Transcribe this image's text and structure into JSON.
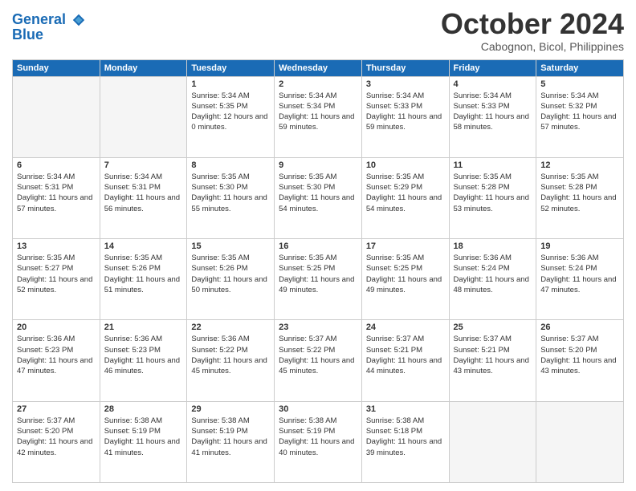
{
  "header": {
    "logo_line1": "General",
    "logo_line2": "Blue",
    "month": "October 2024",
    "location": "Cabognon, Bicol, Philippines"
  },
  "days_of_week": [
    "Sunday",
    "Monday",
    "Tuesday",
    "Wednesday",
    "Thursday",
    "Friday",
    "Saturday"
  ],
  "weeks": [
    [
      {
        "day": "",
        "empty": true
      },
      {
        "day": "",
        "empty": true
      },
      {
        "day": "1",
        "sunrise": "Sunrise: 5:34 AM",
        "sunset": "Sunset: 5:35 PM",
        "daylight": "Daylight: 12 hours and 0 minutes."
      },
      {
        "day": "2",
        "sunrise": "Sunrise: 5:34 AM",
        "sunset": "Sunset: 5:34 PM",
        "daylight": "Daylight: 11 hours and 59 minutes."
      },
      {
        "day": "3",
        "sunrise": "Sunrise: 5:34 AM",
        "sunset": "Sunset: 5:33 PM",
        "daylight": "Daylight: 11 hours and 59 minutes."
      },
      {
        "day": "4",
        "sunrise": "Sunrise: 5:34 AM",
        "sunset": "Sunset: 5:33 PM",
        "daylight": "Daylight: 11 hours and 58 minutes."
      },
      {
        "day": "5",
        "sunrise": "Sunrise: 5:34 AM",
        "sunset": "Sunset: 5:32 PM",
        "daylight": "Daylight: 11 hours and 57 minutes."
      }
    ],
    [
      {
        "day": "6",
        "sunrise": "Sunrise: 5:34 AM",
        "sunset": "Sunset: 5:31 PM",
        "daylight": "Daylight: 11 hours and 57 minutes."
      },
      {
        "day": "7",
        "sunrise": "Sunrise: 5:34 AM",
        "sunset": "Sunset: 5:31 PM",
        "daylight": "Daylight: 11 hours and 56 minutes."
      },
      {
        "day": "8",
        "sunrise": "Sunrise: 5:35 AM",
        "sunset": "Sunset: 5:30 PM",
        "daylight": "Daylight: 11 hours and 55 minutes."
      },
      {
        "day": "9",
        "sunrise": "Sunrise: 5:35 AM",
        "sunset": "Sunset: 5:30 PM",
        "daylight": "Daylight: 11 hours and 54 minutes."
      },
      {
        "day": "10",
        "sunrise": "Sunrise: 5:35 AM",
        "sunset": "Sunset: 5:29 PM",
        "daylight": "Daylight: 11 hours and 54 minutes."
      },
      {
        "day": "11",
        "sunrise": "Sunrise: 5:35 AM",
        "sunset": "Sunset: 5:28 PM",
        "daylight": "Daylight: 11 hours and 53 minutes."
      },
      {
        "day": "12",
        "sunrise": "Sunrise: 5:35 AM",
        "sunset": "Sunset: 5:28 PM",
        "daylight": "Daylight: 11 hours and 52 minutes."
      }
    ],
    [
      {
        "day": "13",
        "sunrise": "Sunrise: 5:35 AM",
        "sunset": "Sunset: 5:27 PM",
        "daylight": "Daylight: 11 hours and 52 minutes."
      },
      {
        "day": "14",
        "sunrise": "Sunrise: 5:35 AM",
        "sunset": "Sunset: 5:26 PM",
        "daylight": "Daylight: 11 hours and 51 minutes."
      },
      {
        "day": "15",
        "sunrise": "Sunrise: 5:35 AM",
        "sunset": "Sunset: 5:26 PM",
        "daylight": "Daylight: 11 hours and 50 minutes."
      },
      {
        "day": "16",
        "sunrise": "Sunrise: 5:35 AM",
        "sunset": "Sunset: 5:25 PM",
        "daylight": "Daylight: 11 hours and 49 minutes."
      },
      {
        "day": "17",
        "sunrise": "Sunrise: 5:35 AM",
        "sunset": "Sunset: 5:25 PM",
        "daylight": "Daylight: 11 hours and 49 minutes."
      },
      {
        "day": "18",
        "sunrise": "Sunrise: 5:36 AM",
        "sunset": "Sunset: 5:24 PM",
        "daylight": "Daylight: 11 hours and 48 minutes."
      },
      {
        "day": "19",
        "sunrise": "Sunrise: 5:36 AM",
        "sunset": "Sunset: 5:24 PM",
        "daylight": "Daylight: 11 hours and 47 minutes."
      }
    ],
    [
      {
        "day": "20",
        "sunrise": "Sunrise: 5:36 AM",
        "sunset": "Sunset: 5:23 PM",
        "daylight": "Daylight: 11 hours and 47 minutes."
      },
      {
        "day": "21",
        "sunrise": "Sunrise: 5:36 AM",
        "sunset": "Sunset: 5:23 PM",
        "daylight": "Daylight: 11 hours and 46 minutes."
      },
      {
        "day": "22",
        "sunrise": "Sunrise: 5:36 AM",
        "sunset": "Sunset: 5:22 PM",
        "daylight": "Daylight: 11 hours and 45 minutes."
      },
      {
        "day": "23",
        "sunrise": "Sunrise: 5:37 AM",
        "sunset": "Sunset: 5:22 PM",
        "daylight": "Daylight: 11 hours and 45 minutes."
      },
      {
        "day": "24",
        "sunrise": "Sunrise: 5:37 AM",
        "sunset": "Sunset: 5:21 PM",
        "daylight": "Daylight: 11 hours and 44 minutes."
      },
      {
        "day": "25",
        "sunrise": "Sunrise: 5:37 AM",
        "sunset": "Sunset: 5:21 PM",
        "daylight": "Daylight: 11 hours and 43 minutes."
      },
      {
        "day": "26",
        "sunrise": "Sunrise: 5:37 AM",
        "sunset": "Sunset: 5:20 PM",
        "daylight": "Daylight: 11 hours and 43 minutes."
      }
    ],
    [
      {
        "day": "27",
        "sunrise": "Sunrise: 5:37 AM",
        "sunset": "Sunset: 5:20 PM",
        "daylight": "Daylight: 11 hours and 42 minutes."
      },
      {
        "day": "28",
        "sunrise": "Sunrise: 5:38 AM",
        "sunset": "Sunset: 5:19 PM",
        "daylight": "Daylight: 11 hours and 41 minutes."
      },
      {
        "day": "29",
        "sunrise": "Sunrise: 5:38 AM",
        "sunset": "Sunset: 5:19 PM",
        "daylight": "Daylight: 11 hours and 41 minutes."
      },
      {
        "day": "30",
        "sunrise": "Sunrise: 5:38 AM",
        "sunset": "Sunset: 5:19 PM",
        "daylight": "Daylight: 11 hours and 40 minutes."
      },
      {
        "day": "31",
        "sunrise": "Sunrise: 5:38 AM",
        "sunset": "Sunset: 5:18 PM",
        "daylight": "Daylight: 11 hours and 39 minutes."
      },
      {
        "day": "",
        "empty": true
      },
      {
        "day": "",
        "empty": true
      }
    ]
  ]
}
